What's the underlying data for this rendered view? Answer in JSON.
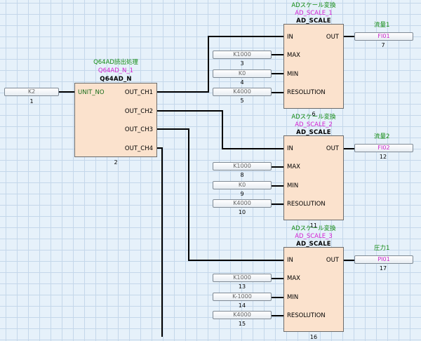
{
  "reader_block": {
    "title": "Q64AD読出処理",
    "instance": "Q64AD_N_1",
    "type": "Q64AD_N",
    "input": "UNIT_NO",
    "outputs": [
      "OUT_CH1",
      "OUT_CH2",
      "OUT_CH3",
      "OUT_CH4"
    ],
    "block_no": "2",
    "input_var": {
      "value": "K2",
      "no": "1"
    }
  },
  "scale_blocks": [
    {
      "title": "ADスケール変換",
      "instance": "AD_SCALE_1",
      "type": "AD_SCALE",
      "pins_in": [
        "IN",
        "MAX",
        "MIN",
        "RESOLUTION"
      ],
      "pin_out": "OUT",
      "block_no": "6",
      "inputs": [
        {
          "value": "K1000",
          "no": "3"
        },
        {
          "value": "K0",
          "no": "4"
        },
        {
          "value": "K4000",
          "no": "5"
        }
      ],
      "output": {
        "label": "流量1",
        "value": "FI01",
        "no": "7"
      }
    },
    {
      "title": "ADスケール変換",
      "instance": "AD_SCALE_2",
      "type": "AD_SCALE",
      "pins_in": [
        "IN",
        "MAX",
        "MIN",
        "RESOLUTION"
      ],
      "pin_out": "OUT",
      "block_no": "11",
      "inputs": [
        {
          "value": "K1000",
          "no": "8"
        },
        {
          "value": "K0",
          "no": "9"
        },
        {
          "value": "K4000",
          "no": "10"
        }
      ],
      "output": {
        "label": "流量2",
        "value": "FI02",
        "no": "12"
      }
    },
    {
      "title": "ADスケール変換",
      "instance": "AD_SCALE_3",
      "type": "AD_SCALE",
      "pins_in": [
        "IN",
        "MAX",
        "MIN",
        "RESOLUTION"
      ],
      "pin_out": "OUT",
      "block_no": "16",
      "inputs": [
        {
          "value": "K1000",
          "no": "13"
        },
        {
          "value": "K-1000",
          "no": "14"
        },
        {
          "value": "K4000",
          "no": "15"
        }
      ],
      "output": {
        "label": "圧力1",
        "value": "PI01",
        "no": "17"
      }
    }
  ],
  "colors": {
    "canvas": "#e6f1fa",
    "grid": "#c4d7ea",
    "block_fill": "#fbe2cd",
    "title_green": "#118a11",
    "instance_magenta": "#d21fd2"
  }
}
